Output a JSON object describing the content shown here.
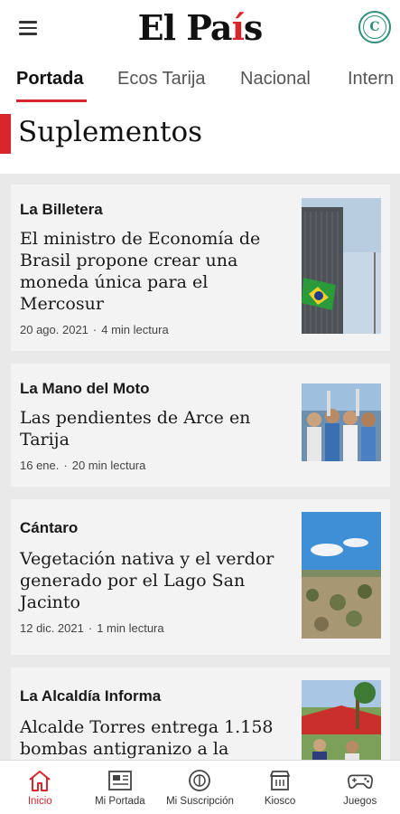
{
  "header": {
    "logo_text_main": "El Pa",
    "logo_text_accent": "í",
    "logo_text_end": "s",
    "avatar_letter": "C"
  },
  "tabs": [
    {
      "label": "Portada",
      "active": true
    },
    {
      "label": "Ecos Tarija",
      "active": false
    },
    {
      "label": "Nacional",
      "active": false
    },
    {
      "label": "Intern",
      "active": false
    }
  ],
  "section": {
    "title": "Suplementos"
  },
  "articles": [
    {
      "kicker": "La Billetera",
      "headline": "El ministro de Economía de Brasil propone crear una moneda única para el Mercosur",
      "date": "20 ago. 2021",
      "read_time": "4 min lectura"
    },
    {
      "kicker": "La Mano del Moto",
      "headline": "Las pendientes de Arce en Tarija",
      "date": "16 ene.",
      "read_time": "20 min lectura"
    },
    {
      "kicker": "Cántaro",
      "headline": "Vegetación nativa y el verdor generado por el Lago San Jacinto",
      "date": "12 dic. 2021",
      "read_time": "1 min lectura"
    },
    {
      "kicker": "La Alcaldía Informa",
      "headline": "Alcalde Torres entrega 1.158 bombas antigranizo a la",
      "date": "",
      "read_time": ""
    }
  ],
  "bottom_nav": [
    {
      "label": "Inicio",
      "icon": "home-icon",
      "active": true
    },
    {
      "label": "Mi Portada",
      "icon": "newspaper-icon",
      "active": false
    },
    {
      "label": "Mi Suscripción",
      "icon": "subscription-icon",
      "active": false
    },
    {
      "label": "Kiosco",
      "icon": "kiosk-icon",
      "active": false
    },
    {
      "label": "Juegos",
      "icon": "gamepad-icon",
      "active": false
    }
  ],
  "colors": {
    "accent": "#d9262c",
    "avatar": "#2f8f7a"
  }
}
